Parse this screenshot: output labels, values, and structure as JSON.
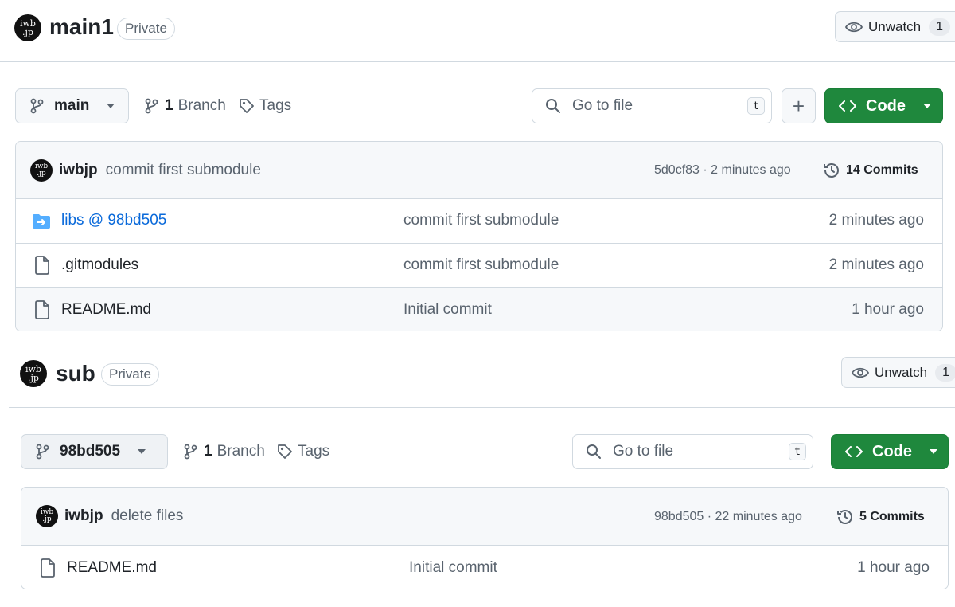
{
  "repos": [
    {
      "name": "main1",
      "visibility": "Private",
      "watch_label": "Unwatch",
      "watch_count": "1",
      "branch_selector": "main",
      "branch_count": "1",
      "branch_label": "Branch",
      "tags_label": "Tags",
      "search_placeholder": "Go to file",
      "search_shortcut": "t",
      "add_file_symbol": "+",
      "code_label": "Code",
      "avatar_text": {
        "line1": "iwb",
        "line2": ".jp"
      },
      "latest_commit": {
        "author": "iwbjp",
        "message": "commit first submodule",
        "hash": "5d0cf83",
        "separator": "·",
        "time": "2 minutes ago",
        "commits_label": "14 Commits"
      },
      "files": [
        {
          "name": "libs @ 98bd505",
          "icon": "submodule-folder-icon",
          "message": "commit first submodule",
          "time": "2 minutes ago"
        },
        {
          "name": ".gitmodules",
          "icon": "file-icon",
          "message": "commit first submodule",
          "time": "2 minutes ago"
        },
        {
          "name": "README.md",
          "icon": "file-icon",
          "message": "Initial commit",
          "time": "1 hour ago"
        }
      ]
    },
    {
      "name": "sub",
      "visibility": "Private",
      "watch_label": "Unwatch",
      "watch_count": "1",
      "branch_selector": "98bd505",
      "branch_count": "1",
      "branch_label": "Branch",
      "tags_label": "Tags",
      "search_placeholder": "Go to file",
      "search_shortcut": "t",
      "code_label": "Code",
      "avatar_text": {
        "line1": "iwb",
        "line2": ".jp"
      },
      "latest_commit": {
        "author": "iwbjp",
        "message": "delete files",
        "hash": "98bd505",
        "separator": "·",
        "time": "22 minutes ago",
        "commits_label": "5 Commits"
      },
      "files": [
        {
          "name": "README.md",
          "icon": "file-icon",
          "message": "Initial commit",
          "time": "1 hour ago"
        }
      ]
    }
  ],
  "colors": {
    "code_button": "#1f883d",
    "link": "#0969da",
    "muted_text": "#59636e",
    "border": "#d1d9e0",
    "header_bg": "#f6f8fa",
    "submodule_icon": "#54aeff"
  }
}
